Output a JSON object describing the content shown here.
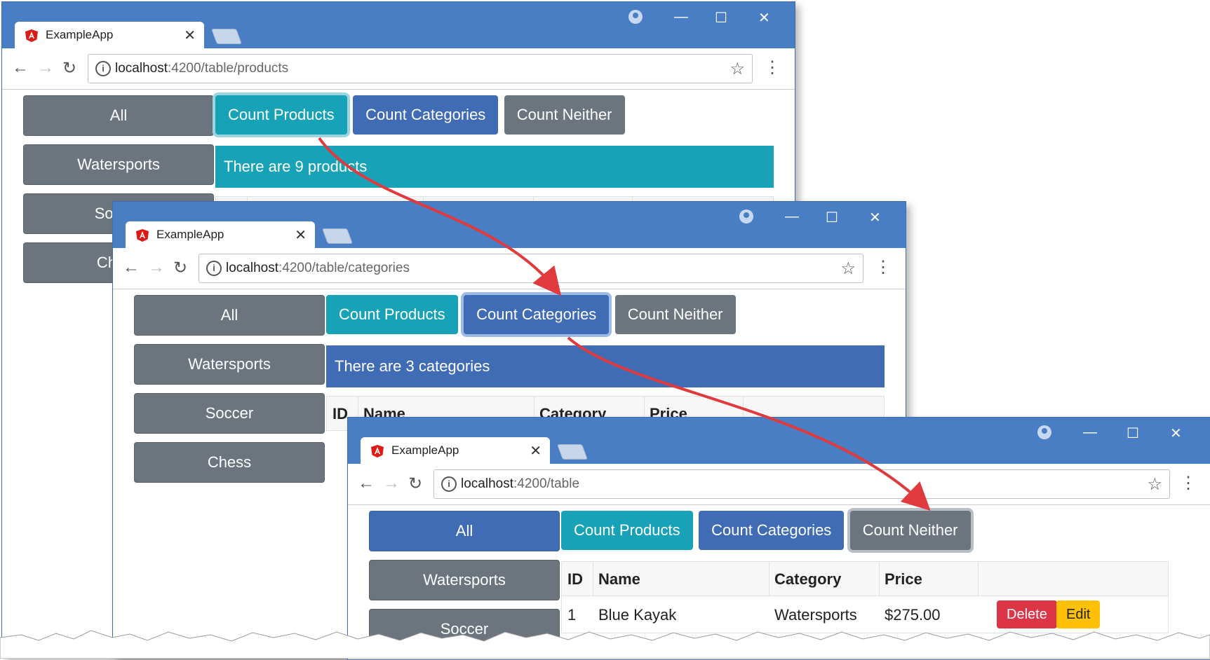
{
  "app_title": "ExampleApp",
  "window_controls": {
    "minimize": "—",
    "maximize": "☐",
    "close": "✕"
  },
  "nav": {
    "back": "←",
    "forward": "→",
    "reload": "↻",
    "menu": "⋮",
    "bookmark": "☆",
    "info": "i"
  },
  "categories": [
    "All",
    "Watersports",
    "Soccer",
    "Chess"
  ],
  "count_buttons": {
    "products": "Count Products",
    "categories": "Count Categories",
    "neither": "Count Neither"
  },
  "windows": [
    {
      "url_host": "localhost",
      "url_path": ":4200/table/products",
      "banner": "There are 9 products",
      "active_count_button": "products"
    },
    {
      "url_host": "localhost",
      "url_path": ":4200/table/categories",
      "banner": "There are 3 categories",
      "active_count_button": "categories",
      "table_headers": [
        "ID",
        "Name",
        "Category",
        "Price"
      ]
    },
    {
      "url_host": "localhost",
      "url_path": ":4200/table",
      "active_count_button": "neither",
      "active_category": "All",
      "table_headers": [
        "ID",
        "Name",
        "Category",
        "Price"
      ],
      "rows": [
        {
          "id": "1",
          "name": "Blue Kayak",
          "category": "Watersports",
          "price": "$275.00",
          "delete_label": "Delete",
          "edit_label": "Edit"
        }
      ]
    }
  ],
  "colors": {
    "titlebar": "#4a7ec4",
    "info": "#17a2b8",
    "primary": "#3f6cb5",
    "secondary": "#6c757d",
    "danger": "#dc3545",
    "warning": "#ffc107",
    "arrow": "#e03a3e"
  }
}
